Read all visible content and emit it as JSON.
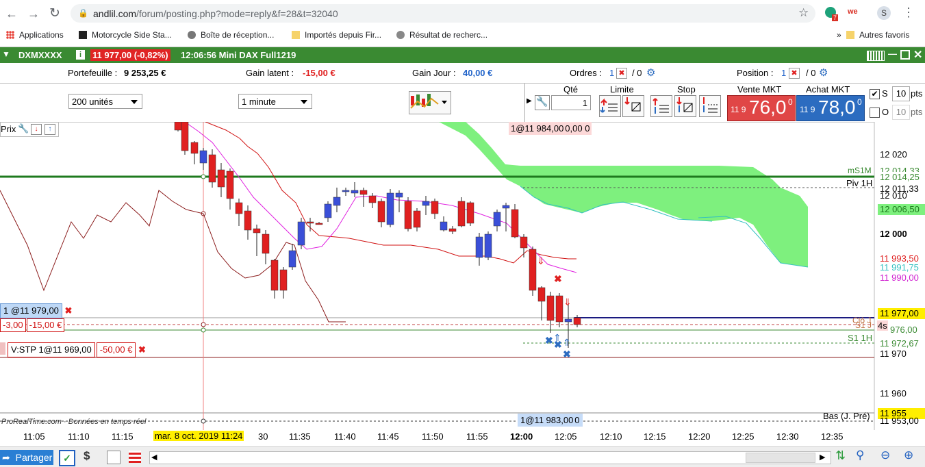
{
  "browser": {
    "url_host": "andlil.com",
    "url_path": "/forum/posting.php?mode=reply&f=28&t=32040",
    "bookmarks": [
      "Applications",
      "Motorcycle Side Sta...",
      "Boîte de réception...",
      "Importés depuis Fir...",
      "Résultat de recherc...",
      "Autres favoris"
    ],
    "ext_badge": "7",
    "ext_we": "we",
    "profile": "S"
  },
  "platform": {
    "symbol": "DXMXXXX",
    "price_change": "11 977,00 (-0,82%)",
    "time_name": "12:06:56 Mini DAX Full1219",
    "portefeuille_label": "Portefeuille :",
    "portefeuille": "9 253,25 €",
    "gain_latent_label": "Gain latent :",
    "gain_latent": "-15,00 €",
    "gain_jour_label": "Gain Jour :",
    "gain_jour": "40,00 €",
    "ordres_label": "Ordres :",
    "ordres_count": "1",
    "ordres_zero": "/ 0",
    "position_label": "Position :",
    "position_count": "1",
    "position_zero": "/ 0"
  },
  "toolbar": {
    "units": "200 unités",
    "interval": "1 minute",
    "qte_label": "Qté",
    "qte_value": "1",
    "limite_label": "Limite",
    "stop_label": "Stop",
    "vente_label": "Vente MKT",
    "vente_small": "11 9",
    "vente_big": "76,0",
    "vente_sup": "0",
    "achat_label": "Achat MKT",
    "achat_small": "11 9",
    "achat_big": "78,0",
    "achat_sup": "0",
    "s_label": "S",
    "s_value": "10",
    "o_label": "O",
    "o_value": "10",
    "pts": "pts"
  },
  "chart": {
    "prix_label": "Prix",
    "top_order": "1@11 984,00",
    "top_order_tail": "0,00 0",
    "order_buy": "1 @11 979,00",
    "order_buy_pl1": "-3,00",
    "order_buy_pl2": "-15,00 €",
    "stop_order": "V:STP 1@11 969,00",
    "stop_pl": "-50,00 €",
    "bottom_order": "1@11 983,00",
    "bottom_order_tail": "0",
    "watermark": "ProRealTime.com · Données en temps réel",
    "labels_right": {
      "ms1m": "mS1M",
      "piv1h": "Piv 1H",
      "s1_1h": "S1 1H",
      "bas": "Bas (J. Pré)",
      "s1j": "S1 J",
      "cloj": "Clô J",
      "fours": "4s"
    },
    "price_axis": [
      "12 020",
      "12 014,25",
      "12 011,33",
      "12 006,50",
      "12 000",
      "11 993,50",
      "11 991,75",
      "11 990,00",
      "11 977,00",
      "976,00",
      "11 972,67",
      "11 970",
      "11 960",
      "11 955",
      "11 953,00",
      "12 014,33",
      "12 010"
    ],
    "time_axis": [
      "11:05",
      "11:10",
      "11:15",
      "mar. 8 oct. 2019 11:24",
      "30",
      "11:35",
      "11:40",
      "11:45",
      "11:50",
      "11:55",
      "12:00",
      "12:05",
      "12:10",
      "12:15",
      "12:20",
      "12:25",
      "12:30",
      "12:35"
    ]
  },
  "bottom": {
    "share": "Partager"
  },
  "colors": {
    "green_header": "#3a8a32",
    "bull": "#3a4fd8",
    "bear": "#e02020",
    "cloud": "#7ef07e",
    "sell": "#e04646",
    "buy": "#2c6cc0"
  },
  "chart_data": {
    "type": "candlestick",
    "x": [
      "11:05",
      "11:10",
      "11:15",
      "11:20",
      "11:25",
      "11:30",
      "11:35",
      "11:40",
      "11:45",
      "11:50",
      "11:55",
      "12:00",
      "12:05"
    ],
    "ylim": [
      11953,
      12027
    ],
    "price_scale": {
      "y_top": 12020,
      "y_bottom": 11960
    }
  }
}
